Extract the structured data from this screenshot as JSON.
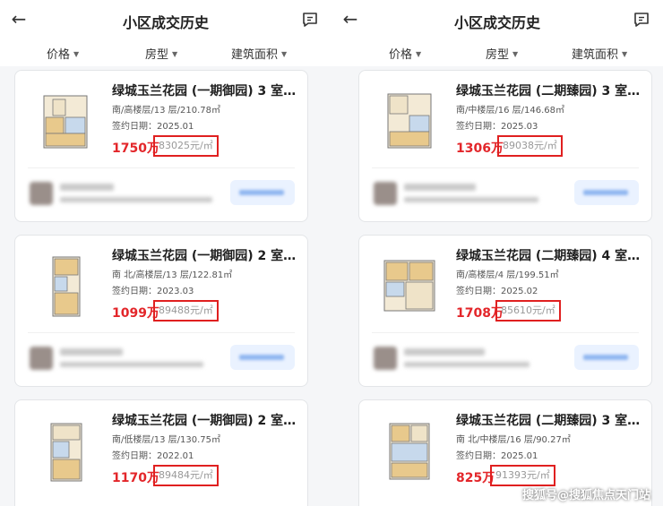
{
  "header": {
    "title": "小区成交历史",
    "back_icon": "back-arrow-icon",
    "message_icon": "message-icon"
  },
  "filters": [
    {
      "label": "价格"
    },
    {
      "label": "房型"
    },
    {
      "label": "建筑面积"
    }
  ],
  "left_listings": [
    {
      "name": "绿城玉兰花园 (一期御园) 3 室…",
      "detail": "南/高楼层/13 层/210.78㎡",
      "date": "签约日期：2025.01",
      "total_price": "1750万",
      "unit_price": "83025元/㎡"
    },
    {
      "name": "绿城玉兰花园 (一期御园) 2 室…",
      "detail": "南 北/高楼层/13 层/122.81㎡",
      "date": "签约日期：2023.03",
      "total_price": "1099万",
      "unit_price": "89488元/㎡"
    },
    {
      "name": "绿城玉兰花园 (一期御园) 2 室…",
      "detail": "南/低楼层/13 层/130.75㎡",
      "date": "签约日期：2022.01",
      "total_price": "1170万",
      "unit_price": "89484元/㎡"
    }
  ],
  "right_listings": [
    {
      "name": "绿城玉兰花园 (二期臻园) 3 室…",
      "detail": "南/中楼层/16 层/146.68㎡",
      "date": "签约日期：2025.03",
      "total_price": "1306万",
      "unit_price": "89038元/㎡"
    },
    {
      "name": "绿城玉兰花园 (二期臻园) 4 室…",
      "detail": "南/高楼层/4 层/199.51㎡",
      "date": "签约日期：2025.02",
      "total_price": "1708万",
      "unit_price": "85610元/㎡"
    },
    {
      "name": "绿城玉兰花园 (二期臻园) 3 室…",
      "detail": "南 北/中楼层/16 层/90.27㎡",
      "date": "签约日期：2025.01",
      "total_price": "825万",
      "unit_price": "91393元/㎡"
    }
  ],
  "watermark": "搜狐号@搜狐焦点天门站",
  "colors": {
    "price": "#e3262a",
    "highlight_box": "#e02020",
    "agent_button": "#eaf2ff"
  }
}
